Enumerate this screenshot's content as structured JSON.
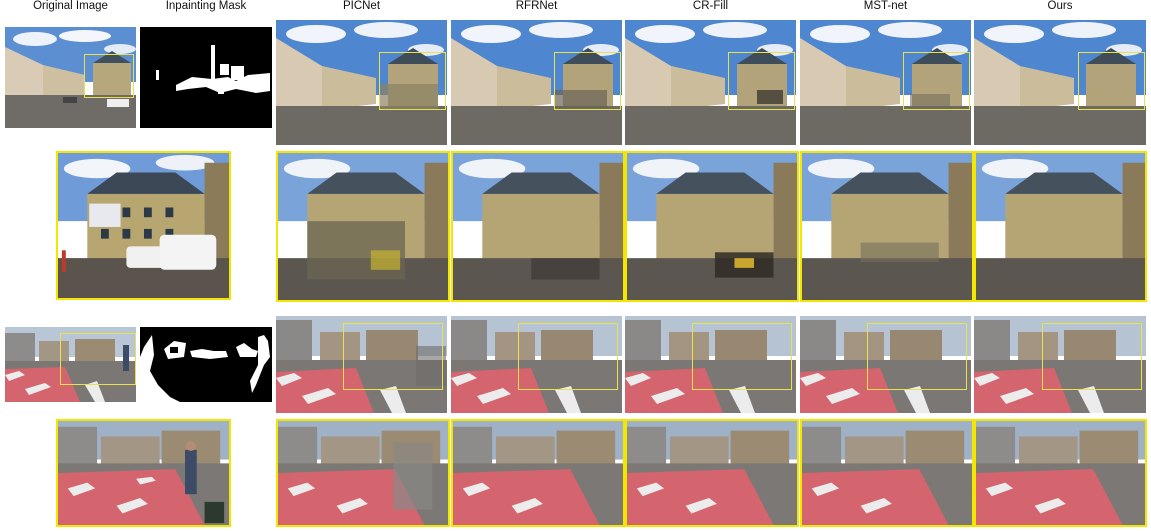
{
  "figure": {
    "column_headers": [
      "Original  Image",
      "Inpainting Mask",
      "PICNet",
      "RFRNet",
      "CR-Fill",
      "MST-net",
      "Ours"
    ]
  },
  "methods": [
    "PICNet",
    "RFRNet",
    "CR-Fill",
    "MST-net",
    "Ours"
  ],
  "scenes": [
    {
      "id": "street-building",
      "row_type": "full",
      "sky": "#5b8fd1",
      "ground": "#6f6b66"
    },
    {
      "id": "street-building",
      "row_type": "zoom",
      "sky": "#6f9bd8",
      "ground": "#5a544c"
    },
    {
      "id": "crosswalk",
      "row_type": "full",
      "sky": "#b9c6d6",
      "ground": "#7a7774",
      "lane": "#d4656f"
    },
    {
      "id": "crosswalk",
      "row_type": "zoom",
      "sky": "#9fb1c6",
      "ground": "#7b7876",
      "lane": "#d4656f"
    }
  ],
  "colors": {
    "highlight": "#f3e600",
    "mask_fg": "#ffffff",
    "mask_bg": "#000000"
  }
}
